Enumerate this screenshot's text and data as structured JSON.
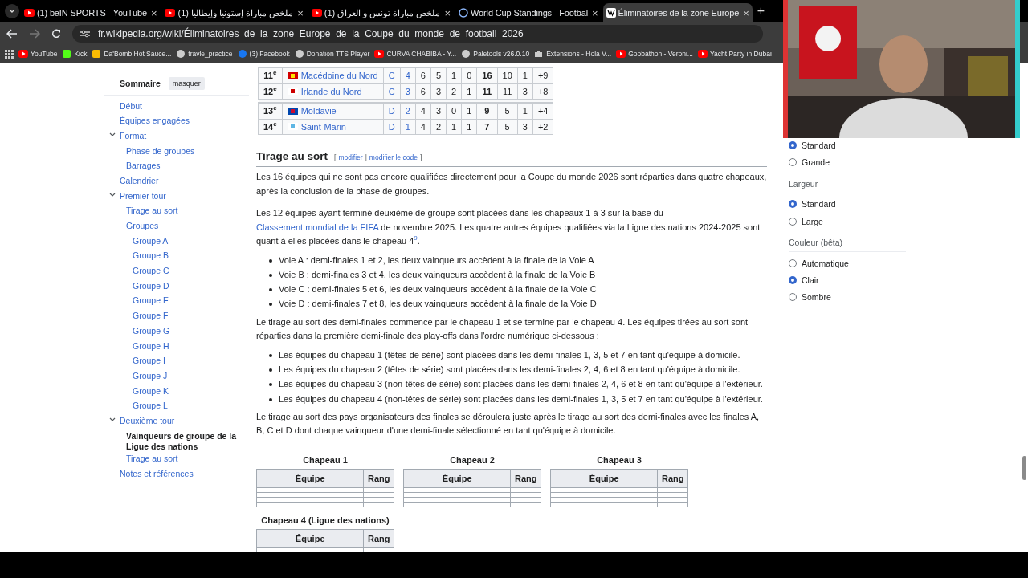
{
  "browser": {
    "tabs": [
      {
        "title": "(1) beIN SPORTS - YouTube",
        "selected": false
      },
      {
        "title": "(1) ملخص مباراة إستونيا وإيطاليا",
        "selected": false
      },
      {
        "title": "(1) ملخص مباراة تونس و العراق",
        "selected": false
      },
      {
        "title": "World Cup Standings - Footbal",
        "selected": false
      },
      {
        "title": "Éliminatoires de la zone Europe",
        "selected": true
      }
    ],
    "close_button": "×",
    "new_tab": "+",
    "url": "fr.wikipedia.org/wiki/Éliminatoires_de_la_zone_Europe_de_la_Coupe_du_monde_de_football_2026",
    "bookmarks": [
      "YouTube",
      "Kick",
      "Da'Bomb Hot Sauce...",
      "travle_practice",
      "(3) Facebook",
      "Donation TTS Player",
      "CURVA CHABIBA - Y...",
      "Paletools v26.0.10",
      "Extensions - Hola V...",
      "Goobathon - Veroni...",
      "Yacht Party in Dubai"
    ]
  },
  "toc": {
    "title": "Sommaire",
    "hide_button": "masquer",
    "items": [
      {
        "label": "Début",
        "selected": false
      },
      {
        "label": "Équipes engagées",
        "selected": false
      },
      {
        "label": "Format",
        "selected": false,
        "expanded": true,
        "children": [
          {
            "label": "Phase de groupes",
            "selected": false
          },
          {
            "label": "Barrages",
            "selected": false
          }
        ]
      },
      {
        "label": "Calendrier",
        "selected": false
      },
      {
        "label": "Premier tour",
        "selected": false,
        "expanded": true,
        "children": [
          {
            "label": "Tirage au sort",
            "selected": false
          },
          {
            "label": "Groupes",
            "selected": false,
            "children": [
              {
                "label": "Groupe A",
                "selected": false
              },
              {
                "label": "Groupe B",
                "selected": false
              },
              {
                "label": "Groupe C",
                "selected": false
              },
              {
                "label": "Groupe D",
                "selected": false
              },
              {
                "label": "Groupe E",
                "selected": false
              },
              {
                "label": "Groupe F",
                "selected": false
              },
              {
                "label": "Groupe G",
                "selected": false
              },
              {
                "label": "Groupe H",
                "selected": false
              },
              {
                "label": "Groupe I",
                "selected": false
              },
              {
                "label": "Groupe J",
                "selected": false
              },
              {
                "label": "Groupe K",
                "selected": false
              },
              {
                "label": "Groupe L",
                "selected": false
              }
            ]
          }
        ]
      },
      {
        "label": "Deuxième tour",
        "selected": false,
        "expanded": true,
        "children": [
          {
            "label": "Vainqueurs de groupe de la Ligue des nations",
            "selected": true
          },
          {
            "label": "Tirage au sort",
            "selected": false
          }
        ]
      },
      {
        "label": "Notes et références",
        "selected": false
      }
    ]
  },
  "standings": {
    "rows": [
      {
        "separator_before": false,
        "cells": [
          "11$^{e}$",
          "Macédoine du Nord",
          "C",
          "4",
          "6",
          "5",
          "1",
          "0",
          "16",
          "10",
          "1",
          "+9"
        ]
      },
      {
        "separator_before": false,
        "cells": [
          "12$^{e}$",
          "Irlande du Nord",
          "C",
          "3",
          "6",
          "3",
          "2",
          "1",
          "11",
          "11",
          "3",
          "+8"
        ]
      },
      {
        "separator_before": true,
        "cells": [
          "13$^{e}$",
          "Moldavie",
          "D",
          "2",
          "4",
          "3",
          "0",
          "1",
          "9",
          "5",
          "1",
          "+4"
        ]
      },
      {
        "separator_before": false,
        "cells": [
          "14$^{e}$",
          "Saint-Marin",
          "D",
          "1",
          "4",
          "2",
          "1",
          "1",
          "7",
          "5",
          "3",
          "+2"
        ]
      }
    ]
  },
  "section": {
    "heading": "Tirage au sort",
    "edit_open": "[",
    "edit_links": [
      "modifier",
      "modifier le code"
    ],
    "edit_separator": "|",
    "edit_close": "]",
    "blocks": [
      {
        "kind": "paragraph",
        "segments": [
          {
            "kind": "text",
            "text": "Les 16 équipes qui ne sont pas encore qualifiées directement pour la Coupe du monde 2026 sont réparties dans quatre chapeaux, après la conclusion de la phase de groupes."
          }
        ]
      },
      {
        "kind": "paragraph",
        "segments": [
          {
            "kind": "text",
            "text": "Les 12 équipes ayant terminé deuxième de groupe sont placées dans les chapeaux 1 à 3 sur la base du "
          },
          {
            "kind": "link",
            "text": "Classement mondial de la FIFA"
          },
          {
            "kind": "text",
            "text": " de novembre 2025. Les quatre autres équipes qualifiées via la Ligue des nations 2024-2025 sont quant à elles placées dans le chapeau 4"
          },
          {
            "kind": "ref",
            "text": "9"
          },
          {
            "kind": "text",
            "text": "."
          }
        ]
      },
      {
        "kind": "list",
        "items": [
          "Voie A : demi-finales 1 et 2, les deux vainqueurs accèdent à la finale de la Voie A",
          "Voie B : demi-finales 3 et 4, les deux vainqueurs accèdent à la finale de la Voie B",
          "Voie C : demi-finales 5 et 6, les deux vainqueurs accèdent à la finale de la Voie C",
          "Voie D : demi-finales 7 et 8, les deux vainqueurs accèdent à la finale de la Voie D"
        ]
      },
      {
        "kind": "paragraph",
        "segments": [
          {
            "kind": "text",
            "text": "Le tirage au sort des demi-finales commence par le chapeau 1 et se termine par le chapeau 4. Les équipes tirées au sort sont réparties dans la première demi-finale des play-offs dans l'ordre numérique ci-dessous :"
          }
        ]
      },
      {
        "kind": "list",
        "items": [
          "Les équipes du chapeau 1 (têtes de série) sont placées dans les demi-finales 1, 3, 5 et 7 en tant qu'équipe à domicile.",
          "Les équipes du chapeau 2 (têtes de série) sont placées dans les demi-finales 2, 4, 6 et 8 en tant qu'équipe à domicile.",
          "Les équipes du chapeau 3 (non-têtes de série) sont placées dans les demi-finales 2, 4, 6 et 8 en tant qu'équipe à l'extérieur.",
          "Les équipes du chapeau 4 (non-têtes de série) sont placées dans les demi-finales 1, 3, 5 et 7 en tant qu'équipe à l'extérieur."
        ]
      },
      {
        "kind": "paragraph",
        "segments": [
          {
            "kind": "text",
            "text": "Le tirage au sort des pays organisateurs des finales se déroulera juste après le tirage au sort des demi-finales avec les finales A, B, C et D dont chaque vainqueur d'une demi-finale sélectionné en tant qu'équipe à domicile."
          }
        ]
      }
    ]
  },
  "pots": [
    {
      "caption": "Chapeau 1",
      "columns": [
        "Équipe",
        "Rang"
      ]
    },
    {
      "caption": "Chapeau 2",
      "columns": [
        "Équipe",
        "Rang"
      ]
    },
    {
      "caption": "Chapeau 3",
      "columns": [
        "Équipe",
        "Rang"
      ]
    },
    {
      "caption": "Chapeau 4 (Ligue des nations)",
      "columns": [
        "Équipe",
        "Rang"
      ]
    }
  ],
  "settings": {
    "groups": [
      {
        "options": [
          {
            "label": "Standard",
            "selected": true
          },
          {
            "label": "Grande",
            "selected": false
          }
        ]
      },
      {
        "heading": "Largeur",
        "options": [
          {
            "label": "Standard",
            "selected": true
          },
          {
            "label": "Large",
            "selected": false
          }
        ]
      },
      {
        "heading": "Couleur (bêta)",
        "options": [
          {
            "label": "Automatique",
            "selected": false
          },
          {
            "label": "Clair",
            "selected": true
          },
          {
            "label": "Sombre",
            "selected": false
          }
        ]
      }
    ]
  }
}
